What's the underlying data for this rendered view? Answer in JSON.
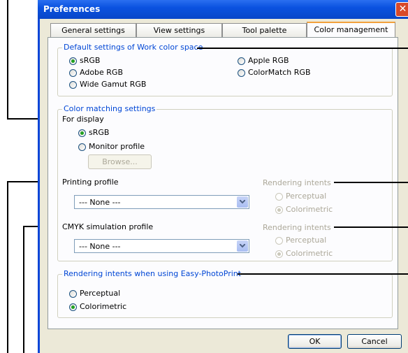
{
  "window": {
    "title": "Preferences",
    "close_glyph": "✕"
  },
  "tabs": [
    {
      "label": "General settings"
    },
    {
      "label": "View settings"
    },
    {
      "label": "Tool palette"
    },
    {
      "label": "Color management"
    }
  ],
  "work_color_space": {
    "legend": "Default settings of Work color space",
    "options": [
      {
        "label": "sRGB",
        "selected": true
      },
      {
        "label": "Adobe RGB",
        "selected": false
      },
      {
        "label": "Wide Gamut RGB",
        "selected": false
      },
      {
        "label": "Apple RGB",
        "selected": false
      },
      {
        "label": "ColorMatch RGB",
        "selected": false
      }
    ]
  },
  "color_matching": {
    "legend": "Color matching settings",
    "for_display_label": "For display",
    "display_options": [
      {
        "label": "sRGB",
        "selected": true
      },
      {
        "label": "Monitor profile",
        "selected": false
      }
    ],
    "browse_label": "Browse...",
    "printing_profile_label": "Printing profile",
    "printing_profile_value": "--- None ---",
    "printing_rendering": {
      "legend": "Rendering intents",
      "options": [
        {
          "label": "Perceptual",
          "selected": false
        },
        {
          "label": "Colorimetric",
          "selected": true
        }
      ]
    },
    "cmyk_label": "CMYK simulation profile",
    "cmyk_value": "--- None ---",
    "cmyk_rendering": {
      "legend": "Rendering intents",
      "options": [
        {
          "label": "Perceptual",
          "selected": false
        },
        {
          "label": "Colorimetric",
          "selected": true
        }
      ]
    }
  },
  "easy_photoprint": {
    "legend": "Rendering intents when using Easy-PhotoPrint",
    "options": [
      {
        "label": "Perceptual",
        "selected": false
      },
      {
        "label": "Colorimetric",
        "selected": true
      }
    ]
  },
  "footer": {
    "ok_label": "OK",
    "cancel_label": "Cancel"
  },
  "colors": {
    "title_bar": "#0a52e0",
    "group_legend": "#0046d5",
    "dialog_bg": "#ece9d8",
    "panel_bg": "#fcfcfe",
    "active_tab_accent": "#f2a13c",
    "selected_radio": "#21a121"
  }
}
